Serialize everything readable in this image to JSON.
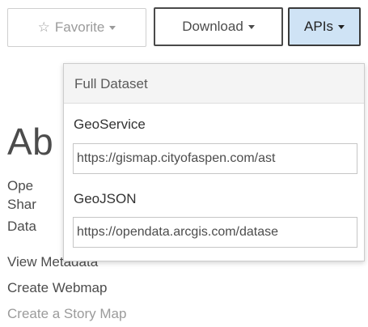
{
  "toolbar": {
    "favorite_label": "Favorite",
    "download_label": "Download",
    "apis_label": "APIs"
  },
  "background": {
    "title_fragment": "Ab",
    "links": [
      "Ope",
      "Shar",
      "Data",
      "View Metadata",
      "Create Webmap",
      "Create a Story Map"
    ]
  },
  "dropdown": {
    "header": "Full Dataset",
    "items": [
      {
        "label": "GeoService",
        "url": "https://gismap.cityofaspen.com/ast"
      },
      {
        "label": "GeoJSON",
        "url": "https://opendata.arcgis.com/datase"
      }
    ]
  },
  "colors": {
    "apis_button_bg": "#cfe3f5",
    "border_dark": "#4a4a4a",
    "muted_text": "#9b9b9b"
  }
}
